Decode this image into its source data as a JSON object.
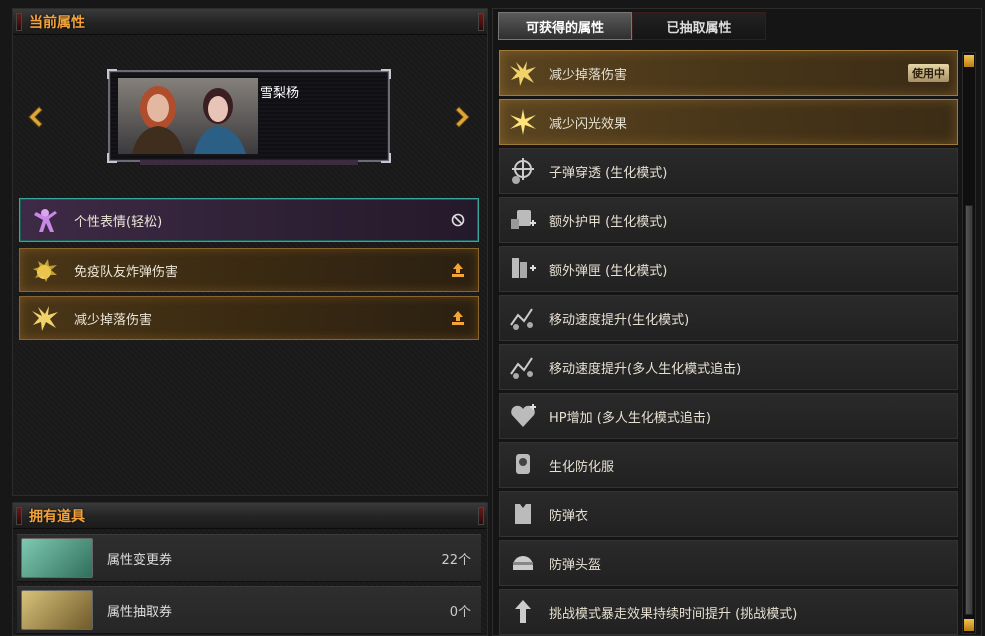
{
  "left": {
    "current_title": "当前属性",
    "character": {
      "name": "雪梨杨"
    },
    "slots": [
      {
        "label": "个性表情(轻松)",
        "end_icon": "block-icon",
        "style": "purple"
      },
      {
        "label": "免疫队友炸弹伤害",
        "end_icon": "upload-icon",
        "style": "gold"
      },
      {
        "label": "减少掉落伤害",
        "end_icon": "upload-icon",
        "style": "gold"
      }
    ],
    "items_title": "拥有道具",
    "items": [
      {
        "name": "属性变更券",
        "count": "22个"
      },
      {
        "name": "属性抽取券",
        "count": "0个"
      }
    ]
  },
  "right": {
    "tabs": [
      {
        "label": "可获得的属性"
      },
      {
        "label": "已抽取属性"
      }
    ],
    "list": [
      {
        "label": "减少掉落伤害",
        "badge": "使用中",
        "style": "gold",
        "icon": "fall-damage-icon"
      },
      {
        "label": "减少闪光效果",
        "badge": "",
        "style": "gold",
        "icon": "flash-icon"
      },
      {
        "label": "子弹穿透 (生化模式)",
        "badge": "",
        "style": "dark",
        "icon": "crosshair-icon"
      },
      {
        "label": "额外护甲 (生化模式)",
        "badge": "",
        "style": "dark",
        "icon": "armor-plus-icon"
      },
      {
        "label": "额外弹匣 (生化模式)",
        "badge": "",
        "style": "dark",
        "icon": "magazine-icon"
      },
      {
        "label": "移动速度提升(生化模式)",
        "badge": "",
        "style": "dark",
        "icon": "speed-icon"
      },
      {
        "label": "移动速度提升(多人生化模式追击)",
        "badge": "",
        "style": "dark",
        "icon": "speed-icon"
      },
      {
        "label": "HP增加 (多人生化模式追击)",
        "badge": "",
        "style": "dark",
        "icon": "hp-icon"
      },
      {
        "label": "生化防化服",
        "badge": "",
        "style": "dark",
        "icon": "hazmat-icon"
      },
      {
        "label": "防弹衣",
        "badge": "",
        "style": "dark",
        "icon": "vest-icon"
      },
      {
        "label": "防弹头盔",
        "badge": "",
        "style": "dark",
        "icon": "helmet-icon"
      },
      {
        "label": "挑战模式暴走效果持续时间提升 (挑战模式)",
        "badge": "",
        "style": "dark",
        "icon": "arrow-up-icon"
      }
    ]
  },
  "colors": {
    "accent": "#f3a33a",
    "selected_border": "#3ba79a",
    "gold_border": "#8a6530"
  }
}
